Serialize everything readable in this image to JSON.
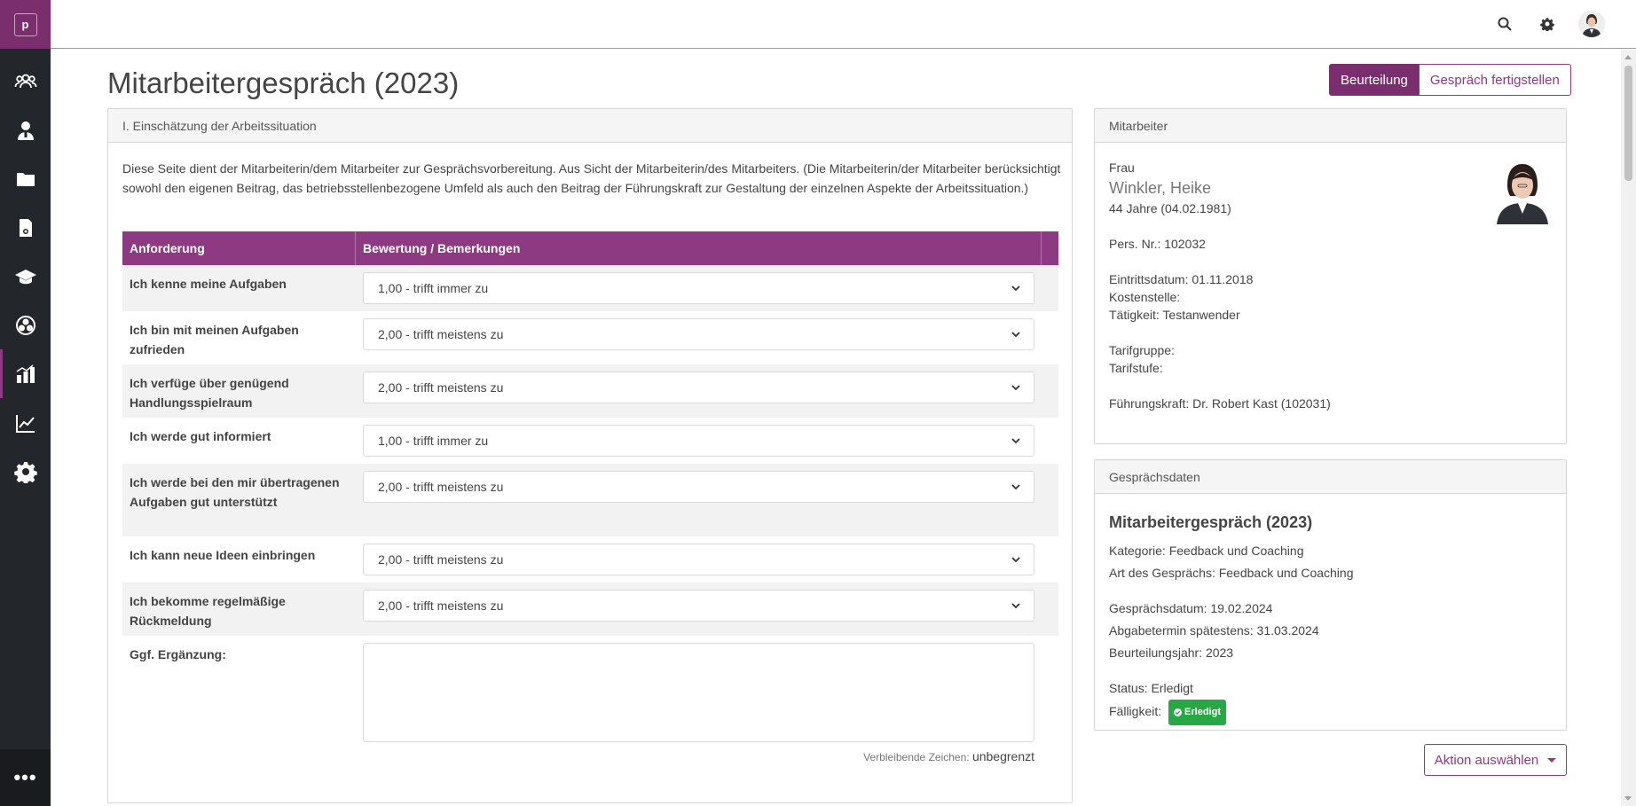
{
  "sidebar": {
    "logo_letter": "p",
    "more_label": "•••",
    "icons": [
      "team-icon",
      "user-manager-icon",
      "folder-icon",
      "document-search-icon",
      "graduation-cap-icon",
      "network-icon",
      "bar-chart-icon",
      "line-chart-icon",
      "settings-gear-icon"
    ],
    "active_index": 6,
    "accent": "#8e3a82"
  },
  "topbar": {
    "icons": [
      "search-icon",
      "gear-icon",
      "user-avatar"
    ]
  },
  "page": {
    "title": "Mitarbeitergespräch (2023)",
    "btn_assess": "Beurteilung",
    "btn_finish": "Gespräch fertigstellen"
  },
  "section": {
    "header": "I. Einschätzung der Arbeitssituation",
    "intro": "Diese Seite dient der Mitarbeiterin/dem Mitarbeiter zur Gesprächsvorbereitung. Aus Sicht der Mitarbeiterin/des Mitarbeiters. (Die Mitarbeiterin/der Mitarbeiter berücksichtigt sowohl den eigenen Beitrag, das betriebsstellenbezogene Umfeld als auch den Beitrag der Führungskraft zur Gestaltung der einzelnen Aspekte der Arbeitssituation.)",
    "col_requirement": "Anforderung",
    "col_rating": "Bewertung / Bemerkungen",
    "rows": [
      {
        "label": "Ich kenne meine Aufgaben",
        "value": "1,00 - trifft immer zu"
      },
      {
        "label": "Ich bin mit meinen Aufgaben zufrieden",
        "value": "2,00 - trifft meistens zu"
      },
      {
        "label": "Ich verfüge über genügend Handlungsspielraum",
        "value": "2,00 - trifft meistens zu"
      },
      {
        "label": "Ich werde gut informiert",
        "value": "1,00 - trifft immer zu"
      },
      {
        "label": "Ich werde bei den mir übertragenen Aufgaben gut unterstützt",
        "value": "2,00 - trifft meistens zu"
      },
      {
        "label": "Ich kann neue Ideen einbringen",
        "value": "2,00 - trifft meistens zu"
      },
      {
        "label": "Ich bekomme regelmäßige Rückmeldung",
        "value": "2,00 - trifft meistens zu"
      }
    ],
    "addition_label": "Ggf. Ergänzung:",
    "remaining_label": "Verbleibende Zeichen:",
    "remaining_value": "unbegrenzt"
  },
  "employee": {
    "header": "Mitarbeiter",
    "salutation": "Frau",
    "name": "Winkler, Heike",
    "age": "44 Jahre (04.02.1981)",
    "pers_nr": "Pers. Nr.: 102032",
    "entry_date": "Eintrittsdatum: 01.11.2018",
    "cost_center": "Kostenstelle:",
    "activity": "Tätigkeit: Testanwender",
    "tariff_group": "Tarifgruppe:",
    "tariff_level": "Tarifstufe:",
    "manager": "Führungskraft: Dr. Robert Kast (102031)"
  },
  "talk": {
    "header": "Gesprächsdaten",
    "title": "Mitarbeitergespräch (2023)",
    "category": "Kategorie: Feedback und Coaching",
    "type": "Art des Gesprächs: Feedback und Coaching",
    "date": "Gesprächsdatum: 19.02.2024",
    "deadline": "Abgabetermin spätestens: 31.03.2024",
    "year": "Beurteilungsjahr: 2023",
    "status": "Status: Erledigt",
    "due_label": "Fälligkeit:",
    "due_badge": "Erledigt"
  },
  "action": {
    "label": "Aktion auswählen"
  }
}
